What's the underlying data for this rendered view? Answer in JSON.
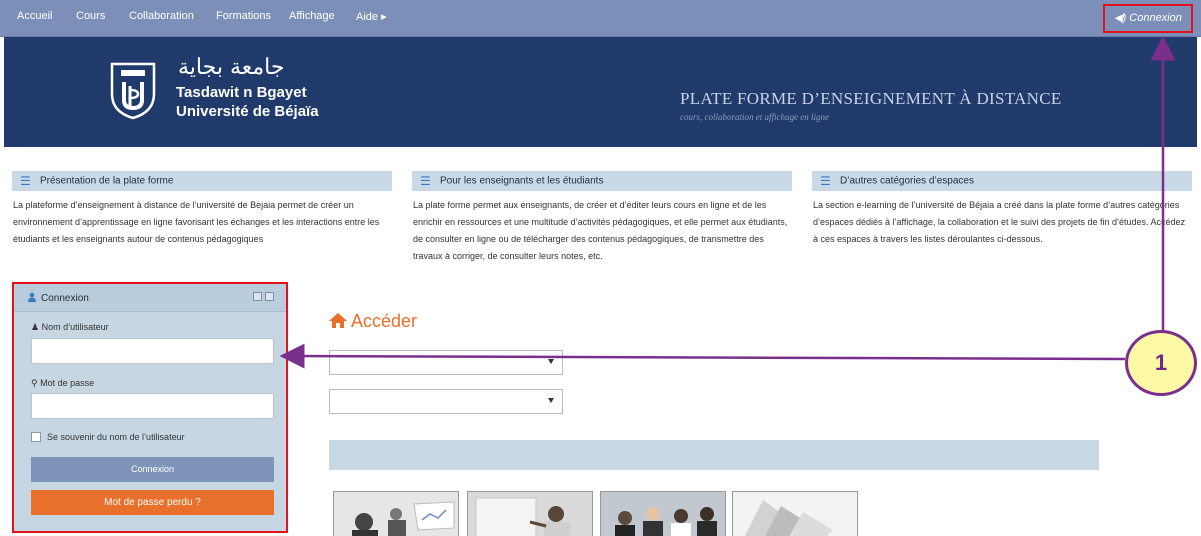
{
  "topnav": {
    "items": [
      "Accueil",
      "Cours",
      "Collaboration",
      "Formations",
      "Affichage",
      "Aide ▸"
    ],
    "login": "◀) Connexion"
  },
  "banner": {
    "arabic_name": "جامعة بجاية",
    "name_line1": "Tasdawit n Bgayet",
    "name_line2": "Université de Béjaïa",
    "title": "PLATE FORME D’ENSEIGNEMENT À DISTANCE",
    "subtitle": "cours, collaboration et affichage en ligne"
  },
  "info": [
    {
      "header": "Présentation de la plate forme",
      "text": "La plateforme d’enseignement à distance de l’université de Bejaia permet de créer un environnement d’apprentissage en ligne favorisant les échanges et les interactions entre les étudiants et les enseignants autour de contenus pédagogiques"
    },
    {
      "header": "Pour les enseignants et les étudiants",
      "text": "La plate forme permet aux enseignants, de créer et d’éditer leurs cours en ligne et de les enrichir en ressources et une multitude d’activités pédagogiques, et elle permet aux étudiants, de consulter en ligne ou de télécharger des contenus pédagogiques, de transmettre des travaux à corriger, de consulter leurs notes, etc."
    },
    {
      "header": "D’autres catégories d’espaces",
      "text": "La section e-learning de l’université de Béjaia a créé dans la plate forme d’autres catégories d’espaces dédiés à l’affichage, la collaboration et le suivi des projets de fin d’études. Accédez à ces espaces à travers les listes déroulantes ci-dessous."
    }
  ],
  "login": {
    "title": "Connexion",
    "username_label": "Nom d’utilisateur",
    "password_label": "Mot de passe",
    "remember_label": "Se souvenir du nom de l’utilisateur",
    "submit_label": "Connexion",
    "lost_label": "Mot de passe perdu ?"
  },
  "acceder": {
    "title": "Accéder"
  },
  "annotation": {
    "number": "1"
  },
  "colors": {
    "nav": "#7b8fb8",
    "banner": "#1f3a6b",
    "accent_orange": "#e8702a",
    "highlight_red": "#e0131b",
    "arrow_purple": "#7a2f8c",
    "callout_fill": "#fbf8a6"
  }
}
